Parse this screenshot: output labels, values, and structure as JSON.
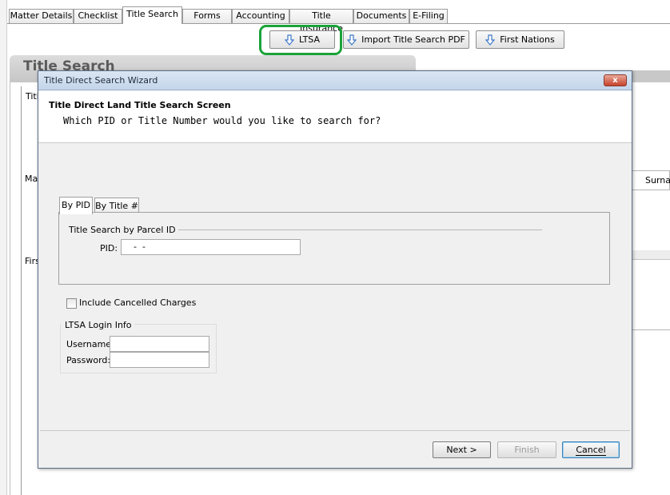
{
  "tabs": [
    {
      "label": "Matter Details"
    },
    {
      "label": "Checklist"
    },
    {
      "label": "Title Search"
    },
    {
      "label": "Forms"
    },
    {
      "label": "Accounting"
    },
    {
      "label": "Title Insurance"
    },
    {
      "label": "Documents"
    },
    {
      "label": "E-Filing"
    }
  ],
  "toolbar": {
    "ltsa_label": "LTSA",
    "import_label": "Import Title Search PDF",
    "first_nations_label": "First Nations"
  },
  "section": {
    "title": "Title Search",
    "fragments": {
      "frag1": "Title",
      "frag2": "Ma",
      "frag3": "Firs",
      "surname": "Surnar"
    }
  },
  "dialog": {
    "window_title": "Title Direct Search Wizard",
    "close_glyph": "x",
    "header_title": "Title Direct Land Title Search Screen",
    "header_subtitle": "Which PID or Title Number would you like to search for?",
    "tabs": [
      {
        "label": "By PID"
      },
      {
        "label": "By Title #"
      }
    ],
    "parcel_group_label": "Title Search by Parcel ID",
    "pid_label": "PID:",
    "pid_value": "  -  -",
    "include_cancelled_label": "Include Cancelled Charges",
    "include_cancelled_checked": false,
    "login_group_label": "LTSA Login Info",
    "username_label": "Username:",
    "username_value": "",
    "password_label": "Password:",
    "password_value": "",
    "buttons": {
      "next": "Next >",
      "finish": "Finish",
      "cancel": "Cancel"
    }
  },
  "colors": {
    "highlight": "#1aa33a",
    "icon_arrow": "#3d78c8",
    "close_button": "#c6422b"
  },
  "icons": {
    "toolbar_button_icon": "down-arrow-icon"
  }
}
